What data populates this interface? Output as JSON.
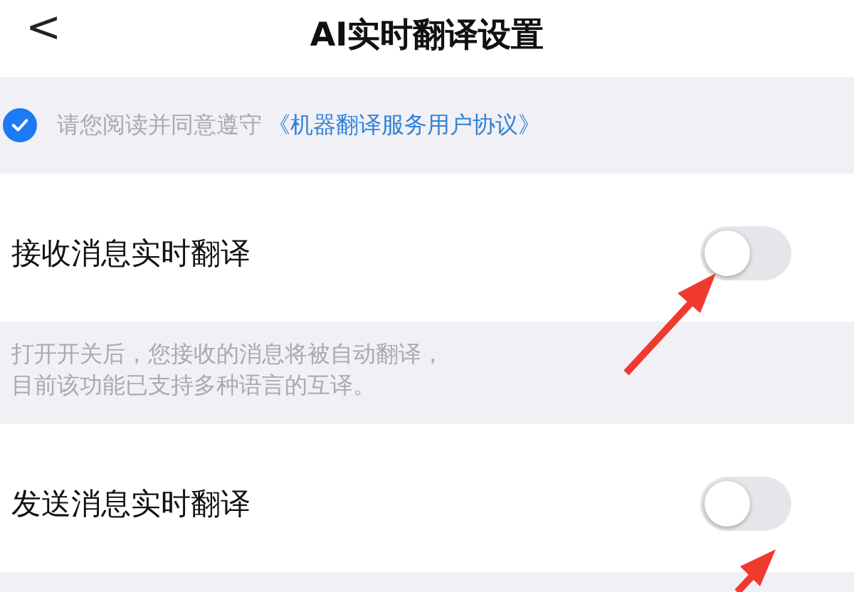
{
  "header": {
    "back": "<",
    "title": "AI实时翻译设置"
  },
  "agreement": {
    "checked": true,
    "text": "请您阅读并同意遵守",
    "link": "《机器翻译服务用户协议》"
  },
  "settings": [
    {
      "label": "接收消息实时翻译",
      "on": false,
      "description": [
        "打开开关后，您接收的消息将被自动翻译，",
        "目前该功能已支持多种语言的互译。"
      ]
    },
    {
      "label": "发送消息实时翻译",
      "on": false
    }
  ],
  "annotations": [
    {
      "kind": "arrow"
    },
    {
      "kind": "arrow"
    }
  ]
}
